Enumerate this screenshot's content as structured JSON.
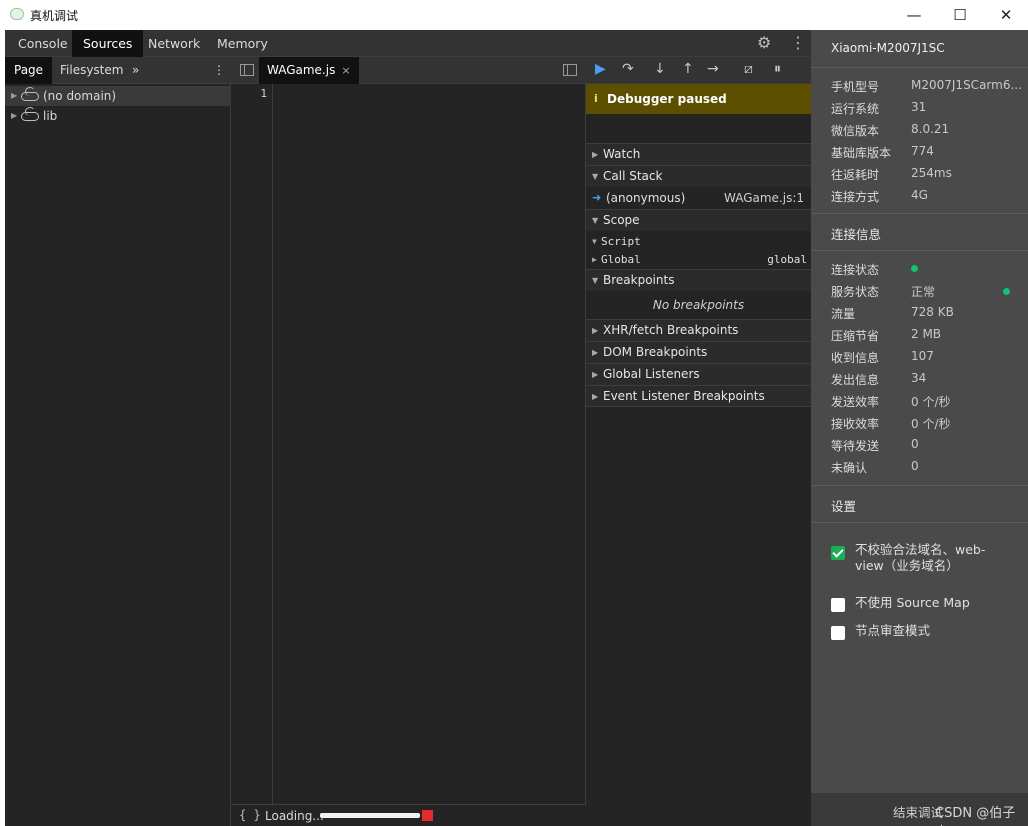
{
  "window": {
    "title": "真机调试",
    "controls": {
      "minimize": "—",
      "maximize": "☐",
      "close": "✕"
    }
  },
  "devtools": {
    "tabs": [
      "Console",
      "Sources",
      "Network",
      "Memory"
    ],
    "active_tab": "Sources",
    "icons": {
      "settings": "gear-icon",
      "more": "kebab-icon"
    }
  },
  "navigator": {
    "tabs": [
      "Page",
      "Filesystem"
    ],
    "more": "»",
    "menu": "⋮",
    "tree": [
      {
        "label": "(no domain)",
        "selected": true
      },
      {
        "label": "lib",
        "selected": false
      }
    ]
  },
  "editor": {
    "file_tab": "WAGame.js",
    "close_glyph": "×",
    "line_number": "1",
    "status": {
      "braces": "{ }",
      "loading": "Loading...",
      "progress": 1.0
    }
  },
  "debugger": {
    "paused_banner": "Debugger paused",
    "sections": {
      "watch": "Watch",
      "call_stack": "Call Stack",
      "scope": "Scope",
      "breakpoints": "Breakpoints",
      "xhr": "XHR/fetch Breakpoints",
      "dom": "DOM Breakpoints",
      "global_listeners": "Global Listeners",
      "event_listeners": "Event Listener Breakpoints"
    },
    "call_frame": {
      "name": "(anonymous)",
      "location": "WAGame.js:1"
    },
    "scope": {
      "script": "Script",
      "global_label": "Global",
      "global_value": "global"
    },
    "no_breakpoints": "No breakpoints"
  },
  "device": {
    "name": "Xiaomi-M2007J1SC",
    "specs": [
      {
        "key": "手机型号",
        "value": "M2007J1SCarm6..."
      },
      {
        "key": "运行系统",
        "value": "31"
      },
      {
        "key": "微信版本",
        "value": "8.0.21"
      },
      {
        "key": "基础库版本",
        "value": "774"
      },
      {
        "key": "往返耗时",
        "value": "254ms"
      },
      {
        "key": "连接方式",
        "value": "4G"
      }
    ],
    "connection_header": "连接信息",
    "connection": [
      {
        "key": "连接状态",
        "value": ""
      },
      {
        "key": "服务状态",
        "value": "正常"
      },
      {
        "key": "流量",
        "value": "728 KB"
      },
      {
        "key": "压缩节省",
        "value": "2 MB"
      },
      {
        "key": "收到信息",
        "value": "107"
      },
      {
        "key": "发出信息",
        "value": "34"
      },
      {
        "key": "发送效率",
        "value": "0 个/秒"
      },
      {
        "key": "接收效率",
        "value": "0 个/秒"
      },
      {
        "key": "等待发送",
        "value": "0"
      },
      {
        "key": "未确认",
        "value": "0"
      }
    ],
    "settings_header": "设置",
    "settings": [
      {
        "label_line1": "不校验合法域名、web-",
        "label_line2": "view（业务域名）",
        "checked": true
      },
      {
        "label_line1": "不使用 Source Map",
        "label_line2": "",
        "checked": false
      },
      {
        "label_line1": "节点审查模式",
        "label_line2": "",
        "checked": false
      }
    ],
    "end_button": "结束调试",
    "watermark": "CSDN @伯子南",
    "status_color": "#12c176"
  }
}
